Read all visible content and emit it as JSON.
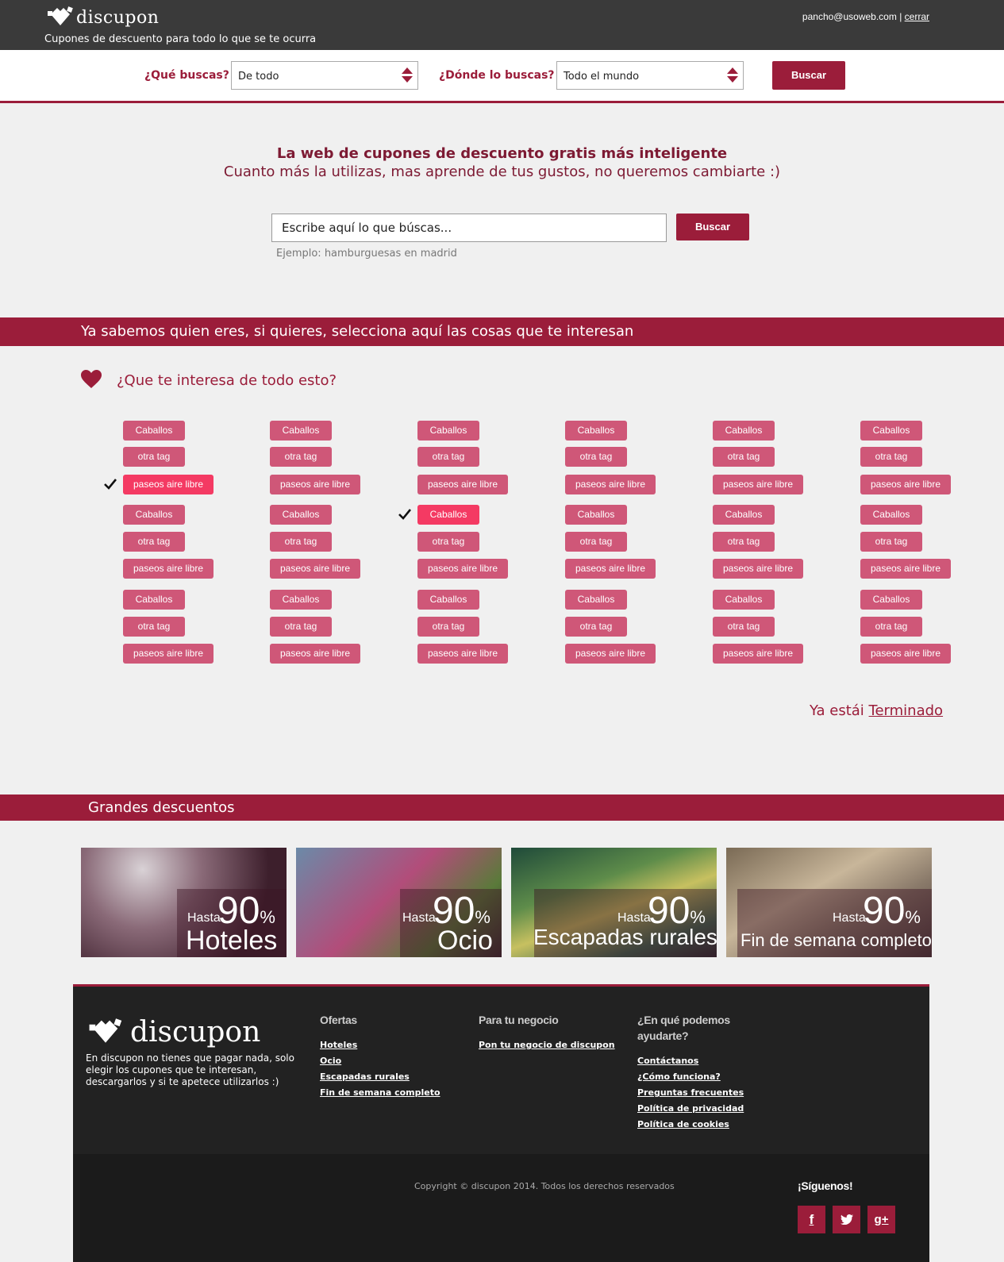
{
  "header": {
    "brand": "discupon",
    "tagline": "Cupones de descuento para todo lo que se te ocurra",
    "user_email": "pancho@usoweb.com",
    "separator": "|",
    "logout_label": "cerrar"
  },
  "searchbar": {
    "what_label": "¿Qué buscas?",
    "what_value": "De todo",
    "where_label": "¿Dónde lo buscas?",
    "where_value": "Todo el mundo",
    "button_label": "Buscar"
  },
  "hero": {
    "title": "La web de cupones de descuento gratis más inteligente",
    "subtitle": "Cuanto más la utilizas, mas aprende de tus gustos, no queremos cambiarte :)",
    "search_placeholder": "Escribe aquí lo que búscas...",
    "button_label": "Buscar",
    "example": "Ejemplo: hamburguesas en madrid"
  },
  "interests": {
    "banner": "Ya sabemos quien eres, si quieres, selecciona aquí las cosas que te interesan",
    "question": "¿Que te interesa de todo esto?",
    "tag_labels": [
      "Caballos",
      "otra tag",
      "paseos aire libre"
    ],
    "selected": [
      {
        "column": 0,
        "row": 2
      },
      {
        "column": 2,
        "row": 3
      }
    ],
    "done_prefix": "Ya estái",
    "done_link": "Terminado"
  },
  "deals": {
    "banner": "Grandes descuentos",
    "hasta_label": "Hasta",
    "items": [
      {
        "percent": "90",
        "name": "Hoteles"
      },
      {
        "percent": "90",
        "name": "Ocio"
      },
      {
        "percent": "90",
        "name": "Escapadas rurales"
      },
      {
        "percent": "90",
        "name": "Fin de semana completo"
      }
    ],
    "percent_sign": "%"
  },
  "footer": {
    "brand": "discupon",
    "description": "En discupon no tienes que pagar nada, solo elegir los cupones que te interesan, descargarlos y si te apetece utilizarlos :)",
    "columns": [
      {
        "title": "Ofertas",
        "links": [
          "Hoteles",
          "Ocio",
          "Escapadas rurales",
          "Fin de semana completo"
        ]
      },
      {
        "title": "Para tu negocio",
        "links": [
          "Pon tu negocio de discupon"
        ]
      },
      {
        "title": "¿En qué podemos ayudarte?",
        "links": [
          "Contáctanos",
          "¿Cómo funciona?",
          "Preguntas frecuentes",
          "Política de privacidad",
          "Política de cookies"
        ]
      }
    ],
    "copyright": "Copyright © discupon 2014. Todos los derechos reservados",
    "follow_label": "¡Síguenos!",
    "social": [
      {
        "icon": "facebook-icon",
        "glyph": "f"
      },
      {
        "icon": "twitter-icon",
        "glyph": "t"
      },
      {
        "icon": "googleplus-icon",
        "glyph": "g+"
      }
    ]
  },
  "colors": {
    "brand": "#9b1d3a",
    "tag": "#cf5778",
    "tag_selected": "#f43a63",
    "header_bg": "#3a3a3a",
    "footer_bg": "#222222"
  }
}
